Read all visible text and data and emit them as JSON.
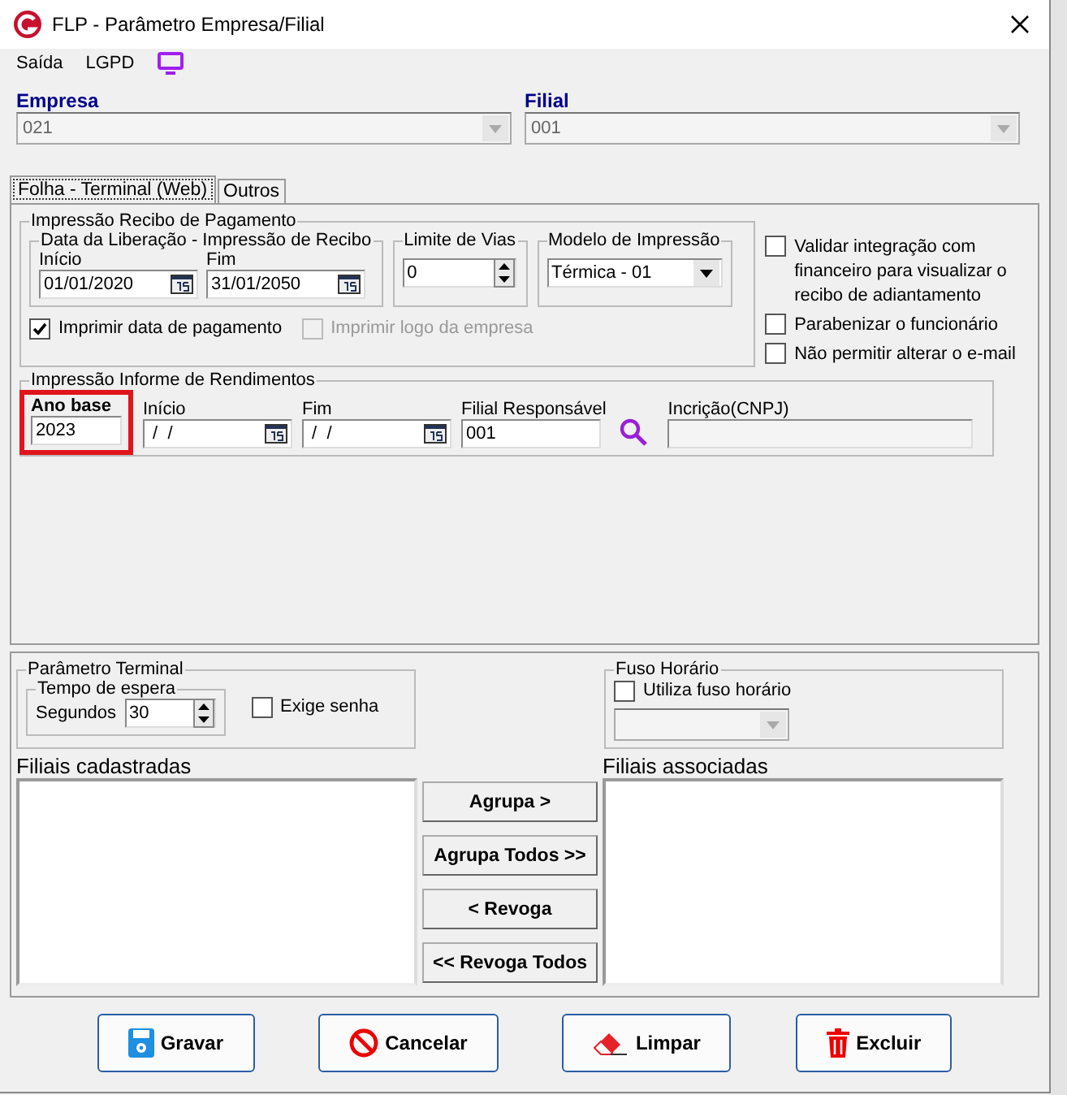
{
  "window": {
    "title": "FLP - Parâmetro Empresa/Filial"
  },
  "menu": [
    {
      "label": "Saída"
    },
    {
      "label": "LGPD"
    }
  ],
  "empresa": {
    "label": "Empresa",
    "value": "021"
  },
  "filial": {
    "label": "Filial",
    "value": "001"
  },
  "tabs": [
    {
      "label": "Folha - Terminal (Web)",
      "selected": true
    },
    {
      "label": "Outros",
      "selected": false
    }
  ],
  "recibo": {
    "title": "Impressão Recibo de Pagamento",
    "data_liberacao": {
      "title": "Data da Liberação - Impressão de Recibo",
      "inicio": {
        "label": "Início",
        "value": "01/01/2020"
      },
      "fim": {
        "label": "Fim",
        "value": "31/01/2050"
      }
    },
    "limite_vias": {
      "title": "Limite de Vias",
      "value": "0"
    },
    "modelo": {
      "title": "Modelo de Impressão",
      "value": "Térmica - 01"
    },
    "checks": [
      {
        "label": "Imprimir data de pagamento",
        "checked": true,
        "disabled": false
      },
      {
        "label": "Imprimir logo da empresa",
        "checked": false,
        "disabled": true
      }
    ]
  },
  "side_options": [
    {
      "label": "Validar integração com financeiro para visualizar o recibo de adiantamento",
      "checked": false
    },
    {
      "label": "Parabenizar o funcionário",
      "checked": false
    },
    {
      "label": "Não permitir alterar o e-mail",
      "checked": false
    }
  ],
  "informe": {
    "title": "Impressão Informe de Rendimentos",
    "ano_base": {
      "label": "Ano base",
      "value": "2023",
      "highlighted": true
    },
    "inicio": {
      "label": "Início",
      "value": " /  /"
    },
    "fim": {
      "label": "Fim",
      "value": " /  /"
    },
    "filial_responsavel": {
      "label": "Filial Responsável",
      "value": "001"
    },
    "cnpj": {
      "label": "Incrição(CNPJ)"
    }
  },
  "terminal": {
    "title": "Parâmetro Terminal",
    "tempo": {
      "title": "Tempo de espera",
      "label": "Segundos",
      "value": "30"
    },
    "exige_senha": {
      "label": "Exige senha",
      "checked": false
    }
  },
  "fuso": {
    "title": "Fuso Horário",
    "utiliza": {
      "label": "Utiliza fuso horário",
      "checked": false
    }
  },
  "lists": [
    {
      "label": "Filiais cadastradas"
    },
    {
      "label": "Filiais associadas"
    }
  ],
  "transfer_buttons": [
    {
      "label": "Agrupa >"
    },
    {
      "label": "Agrupa Todos >>"
    },
    {
      "label": "< Revoga"
    },
    {
      "label": "<< Revoga Todos"
    }
  ],
  "actions": [
    {
      "label": "Gravar",
      "kind": "save"
    },
    {
      "label": "Cancelar",
      "kind": "cancel"
    },
    {
      "label": "Limpar",
      "kind": "clear"
    },
    {
      "label": "Excluir",
      "kind": "delete"
    }
  ]
}
